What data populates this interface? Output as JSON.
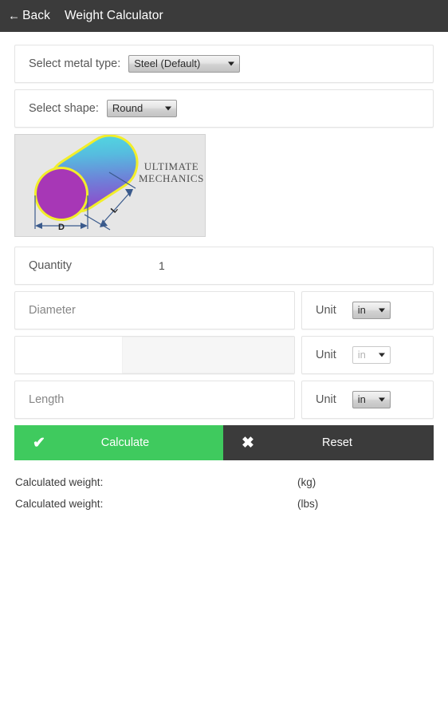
{
  "appbar": {
    "back_icon": "arrow-left-icon",
    "back_label": "Back",
    "title": "Weight Calculator"
  },
  "form": {
    "metal_row": {
      "label": "Select metal type:",
      "selected": "Steel (Default)",
      "caret_icon": "chevron-down-icon"
    },
    "shape_row": {
      "label": "Select shape:",
      "selected": "Round",
      "caret_icon": "chevron-down-icon"
    },
    "diagram": {
      "brand_line1": "ULTIMATE",
      "brand_line2": "MECHANICS",
      "dim_diameter": "D",
      "dim_length": "L",
      "shape_name": "round-bar-diagram",
      "colors": {
        "outline": "#f2ee2a",
        "face": "#a737b6",
        "body_start": "#9b3fc0",
        "body_mid": "#6f7fd8",
        "body_end": "#4fe3e0",
        "background": "#e6e6e6",
        "dim_line": "#3a5a8c"
      }
    },
    "quantity_row": {
      "label": "Quantity",
      "value": "1"
    },
    "diameter_row": {
      "placeholder": "Diameter",
      "value": "",
      "unit_label": "Unit",
      "unit_selected": "in",
      "caret_icon": "chevron-down-icon",
      "enabled": true
    },
    "secondary_row": {
      "placeholder": "",
      "value": "",
      "unit_label": "Unit",
      "unit_selected": "in",
      "caret_icon": "chevron-down-icon",
      "enabled": false
    },
    "length_row": {
      "placeholder": "Length",
      "value": "",
      "unit_label": "Unit",
      "unit_selected": "in",
      "caret_icon": "chevron-down-icon",
      "enabled": true
    }
  },
  "actions": {
    "calculate_label": "Calculate",
    "calculate_icon": "check-icon",
    "calculate_glyph": "✔",
    "calculate_color": "#3fca5e",
    "reset_label": "Reset",
    "reset_icon": "close-icon",
    "reset_glyph": "✖",
    "reset_color": "#3b3b3b"
  },
  "results": [
    {
      "label": "Calculated weight:",
      "value": "",
      "unit": "(kg)"
    },
    {
      "label": "Calculated weight:",
      "value": "",
      "unit": "(lbs)"
    }
  ]
}
